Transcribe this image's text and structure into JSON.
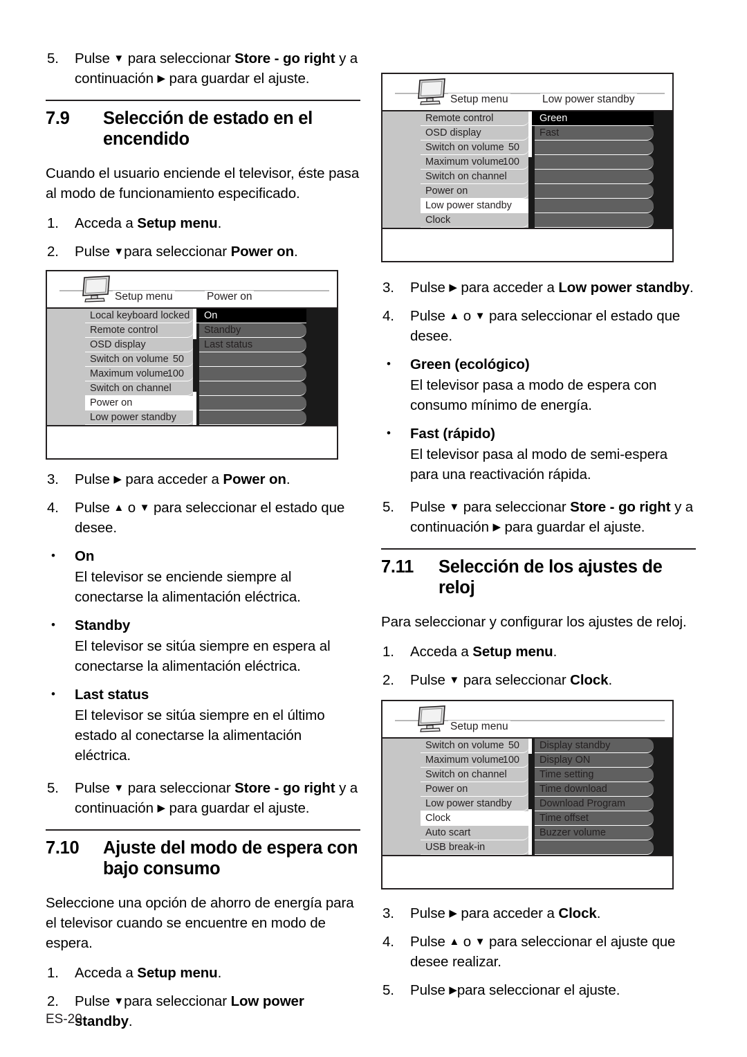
{
  "page": {
    "footer": "ES-20",
    "glyphs": {
      "down": "▼",
      "up": "▲",
      "right": "▶",
      "bullet": "•"
    }
  },
  "left_column": {
    "intro_step": {
      "num": "5.",
      "line1_pre": "Pulse ",
      "line1_tri": "▼",
      "line1_mid": " para seleccionar ",
      "line1_bold": "Store - go right",
      "line2_pre": " y a continuación ",
      "line2_tri": "▶",
      "line2_post": " para guardar el ajuste."
    },
    "section": {
      "number": "7.9",
      "title": "Selección de estado en el encendido"
    },
    "intro_para": "Cuando el usuario enciende el televisor, éste pasa al modo de funcionamiento especificado.",
    "steps_before": [
      {
        "num": "1.",
        "pre": "Acceda a ",
        "bold": "Setup menu",
        "post": "."
      },
      {
        "num": "2.",
        "pre": "Pulse ",
        "tri": "▼",
        "mid": "para seleccionar ",
        "bold": "Power on",
        "post": "."
      }
    ],
    "menu": {
      "title_left": "Setup menu",
      "title_right": "Power on",
      "left_items": [
        {
          "label": "Local keyboard locked",
          "value": "",
          "selected": false
        },
        {
          "label": "Remote control",
          "value": "",
          "selected": false
        },
        {
          "label": "OSD display",
          "value": "",
          "selected": false
        },
        {
          "label": "Switch on volume",
          "value": "50",
          "selected": false
        },
        {
          "label": "Maximum volume",
          "value": "100",
          "selected": false
        },
        {
          "label": "Switch on channel",
          "value": "",
          "selected": false
        },
        {
          "label": "Power on",
          "value": "",
          "selected": true
        },
        {
          "label": "Low power standby",
          "value": "",
          "selected": false
        }
      ],
      "right_items": [
        {
          "label": "On",
          "selected": true
        },
        {
          "label": "Standby",
          "selected": false
        },
        {
          "label": "Last status",
          "selected": false
        },
        {
          "label": "",
          "selected": false
        },
        {
          "label": "",
          "selected": false
        },
        {
          "label": "",
          "selected": false
        },
        {
          "label": "",
          "selected": false
        },
        {
          "label": "",
          "selected": false
        }
      ]
    },
    "steps_after": [
      {
        "num": "3.",
        "pre": "Pulse ",
        "tri": "▶",
        "mid": " para acceder a ",
        "bold": "Power on",
        "post": "."
      },
      {
        "num": "4.",
        "pre": "Pulse ",
        "tri": "▲",
        "mid": " o ",
        "tri2": "▼",
        "post": " para seleccionar el estado que desee."
      }
    ],
    "bullets": [
      {
        "term": "On",
        "text": "El televisor se enciende siempre al conectarse la alimentación eléctrica."
      },
      {
        "term": "Standby",
        "text": "El televisor se sitúa siempre en espera al conectarse la alimentación eléctrica."
      },
      {
        "term": "Last status",
        "text": "El televisor se sitúa siempre en el último estado al conectarse la alimentación eléctrica."
      }
    ],
    "store_step": {
      "num": "5.",
      "line1_pre": "Pulse ",
      "line1_tri": "▼",
      "line1_mid": " para seleccionar ",
      "line1_bold": "Store - go right",
      "line2_pre": " y a continuación ",
      "line2_tri": "▶",
      "line2_post": " para guardar el ajuste."
    },
    "section2": {
      "number": "7.10",
      "title": "Ajuste del modo de espera con bajo consumo"
    },
    "section2_para": "Seleccione una opción de ahorro de energía para el televisor cuando se encuentre en modo de espera.",
    "section2_steps": [
      {
        "num": "1.",
        "pre": "Acceda a ",
        "bold": "Setup menu",
        "post": "."
      },
      {
        "num": "2.",
        "pre": "Pulse ",
        "tri": "▼",
        "mid": "para seleccionar ",
        "bold": "Low power standby",
        "post": "."
      }
    ]
  },
  "right_column": {
    "menu1": {
      "title_left": "Setup menu",
      "title_right": "Low power standby",
      "left_items": [
        {
          "label": "Remote control",
          "value": "",
          "selected": false
        },
        {
          "label": "OSD display",
          "value": "",
          "selected": false
        },
        {
          "label": "Switch on volume",
          "value": "50",
          "selected": false
        },
        {
          "label": "Maximum volume",
          "value": "100",
          "selected": false
        },
        {
          "label": "Switch on channel",
          "value": "",
          "selected": false
        },
        {
          "label": "Power on",
          "value": "",
          "selected": false
        },
        {
          "label": "Low power standby",
          "value": "",
          "selected": true
        },
        {
          "label": "Clock",
          "value": "",
          "selected": false
        }
      ],
      "right_items": [
        {
          "label": "Green",
          "selected": true
        },
        {
          "label": "Fast",
          "selected": false
        },
        {
          "label": "",
          "selected": false
        },
        {
          "label": "",
          "selected": false
        },
        {
          "label": "",
          "selected": false
        },
        {
          "label": "",
          "selected": false
        },
        {
          "label": "",
          "selected": false
        },
        {
          "label": "",
          "selected": false
        }
      ]
    },
    "steps1": [
      {
        "num": "3.",
        "pre": "Pulse ",
        "tri": "▶",
        "mid": " para acceder a ",
        "bold": "Low power standby",
        "post": "."
      },
      {
        "num": "4.",
        "pre": "Pulse ",
        "tri": "▲",
        "mid": " o ",
        "tri2": "▼",
        "post": " para seleccionar el estado que desee."
      }
    ],
    "bullets1": [
      {
        "term": "Green (ecológico)",
        "text": "El televisor pasa a modo de espera con consumo mínimo de energía."
      },
      {
        "term": "Fast (rápido)",
        "text": "El televisor pasa al modo de semi-espera para una reactivación rápida."
      }
    ],
    "store_step": {
      "num": "5.",
      "line1_pre": "Pulse ",
      "line1_tri": "▼",
      "line1_mid": " para seleccionar ",
      "line1_bold": "Store - go right",
      "line2_pre": " y a continuación ",
      "line2_tri": "▶",
      "line2_post": " para guardar el ajuste."
    },
    "section": {
      "number": "7.11",
      "title": "Selección de los ajustes de reloj"
    },
    "section_para": "Para seleccionar y configurar los ajustes de reloj.",
    "steps2": [
      {
        "num": "1.",
        "pre": "Acceda a ",
        "bold": "Setup menu",
        "post": "."
      },
      {
        "num": "2.",
        "pre": "Pulse ",
        "tri": "▼",
        "mid": " para seleccionar ",
        "bold": "Clock",
        "post": "."
      }
    ],
    "menu2": {
      "title_left": "Setup menu",
      "title_right": "",
      "left_items": [
        {
          "label": "Switch on volume",
          "value": "50",
          "selected": false
        },
        {
          "label": "Maximum volume",
          "value": "100",
          "selected": false
        },
        {
          "label": "Switch on channel",
          "value": "",
          "selected": false
        },
        {
          "label": "Power on",
          "value": "",
          "selected": false
        },
        {
          "label": "Low power standby",
          "value": "",
          "selected": false
        },
        {
          "label": "Clock",
          "value": "",
          "selected": true
        },
        {
          "label": "Auto scart",
          "value": "",
          "selected": false
        },
        {
          "label": "USB break-in",
          "value": "",
          "selected": false
        }
      ],
      "right_items": [
        {
          "label": "Display standby",
          "selected": false
        },
        {
          "label": "Display ON",
          "selected": false
        },
        {
          "label": "Time setting",
          "selected": false
        },
        {
          "label": "Time download",
          "selected": false
        },
        {
          "label": "Download Program",
          "selected": false
        },
        {
          "label": "Time offset",
          "selected": false
        },
        {
          "label": "Buzzer volume",
          "selected": false
        },
        {
          "label": "",
          "selected": false
        }
      ]
    },
    "steps3": [
      {
        "num": "3.",
        "pre": "Pulse ",
        "tri": "▶",
        "mid": " para acceder a ",
        "bold": "Clock",
        "post": "."
      },
      {
        "num": "4.",
        "pre": "Pulse ",
        "tri": "▲",
        "mid": " o ",
        "tri2": "▼",
        "post": " para seleccionar el ajuste que desee realizar."
      },
      {
        "num": "5.",
        "pre": "Pulse ",
        "tri": "▶",
        "post": "para seleccionar el ajuste."
      }
    ]
  }
}
